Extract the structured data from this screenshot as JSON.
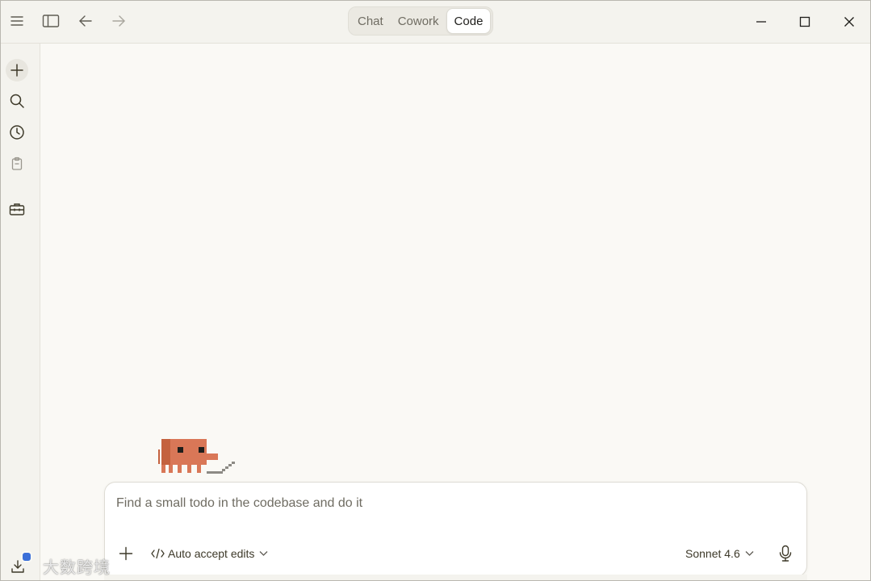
{
  "titlebar": {
    "tabs": [
      {
        "label": "Chat",
        "active": false
      },
      {
        "label": "Cowork",
        "active": false
      },
      {
        "label": "Code",
        "active": true
      }
    ],
    "icons": [
      "menu-icon",
      "sidebar-toggle-icon",
      "back-arrow-icon",
      "forward-arrow-icon"
    ],
    "window_controls": [
      "minimize-icon",
      "maximize-icon",
      "close-icon"
    ]
  },
  "sidebar": {
    "items": [
      {
        "name": "new-session",
        "icon": "plus-icon"
      },
      {
        "name": "search",
        "icon": "search-icon"
      },
      {
        "name": "history",
        "icon": "clock-icon"
      },
      {
        "name": "tasks",
        "icon": "clipboard-icon"
      },
      {
        "name": "tools",
        "icon": "toolbox-icon"
      }
    ],
    "bottom_icon": "download-icon"
  },
  "composer": {
    "placeholder": "Find a small todo in the codebase and do it",
    "mode_label": "Auto accept edits",
    "model_label": "Sonnet 4.6"
  },
  "watermark": "大数跨境",
  "colors": {
    "accent": "#d97757",
    "background": "#faf9f5",
    "sidebar_bg": "#f4f3ee"
  }
}
